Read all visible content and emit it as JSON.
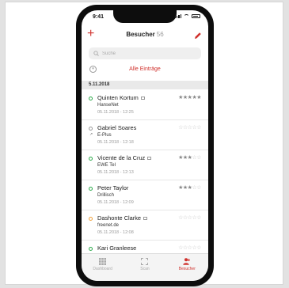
{
  "status": {
    "time": "9:41"
  },
  "nav": {
    "title": "Besucher",
    "count": "56"
  },
  "search": {
    "placeholder": "Suche"
  },
  "filter": {
    "label": "Alle Einträge"
  },
  "section": {
    "date": "5.11.2018"
  },
  "visitors": [
    {
      "name": "Quinten Kortum",
      "company": "HanseNet",
      "datetime": "05.11.2018 - 12:25",
      "status": "green",
      "rating": 5,
      "has_vcard": true,
      "forwarded": false
    },
    {
      "name": "Gabriel Soares",
      "company": "E-Plus",
      "datetime": "05.11.2018 - 12:18",
      "status": "gray",
      "rating": 0,
      "has_vcard": false,
      "forwarded": true
    },
    {
      "name": "Vicente de la Cruz",
      "company": "EWE Tel",
      "datetime": "05.11.2018 - 12:13",
      "status": "green",
      "rating": 3,
      "has_vcard": true,
      "forwarded": false
    },
    {
      "name": "Peter Taylor",
      "company": "Drillisch",
      "datetime": "05.11.2018 - 12:09",
      "status": "green",
      "rating": 3,
      "has_vcard": false,
      "forwarded": false
    },
    {
      "name": "Dashonte Clarke",
      "company": "freenet.de",
      "datetime": "05.11.2018 - 12:08",
      "status": "orange",
      "rating": 0,
      "has_vcard": true,
      "forwarded": false
    },
    {
      "name": "Kari Granleese",
      "company": "",
      "datetime": "",
      "status": "green",
      "rating": 0,
      "has_vcard": false,
      "forwarded": false
    }
  ],
  "tabs": [
    {
      "label": "Dashboard",
      "icon": "grid-icon",
      "active": false
    },
    {
      "label": "Scan",
      "icon": "scan-icon",
      "active": false
    },
    {
      "label": "Besucher",
      "icon": "people-icon",
      "active": true
    }
  ],
  "colors": {
    "accent": "#d0312d",
    "green": "#2eaa4c",
    "orange": "#f0a23c",
    "gray": "#9a9a9a"
  }
}
